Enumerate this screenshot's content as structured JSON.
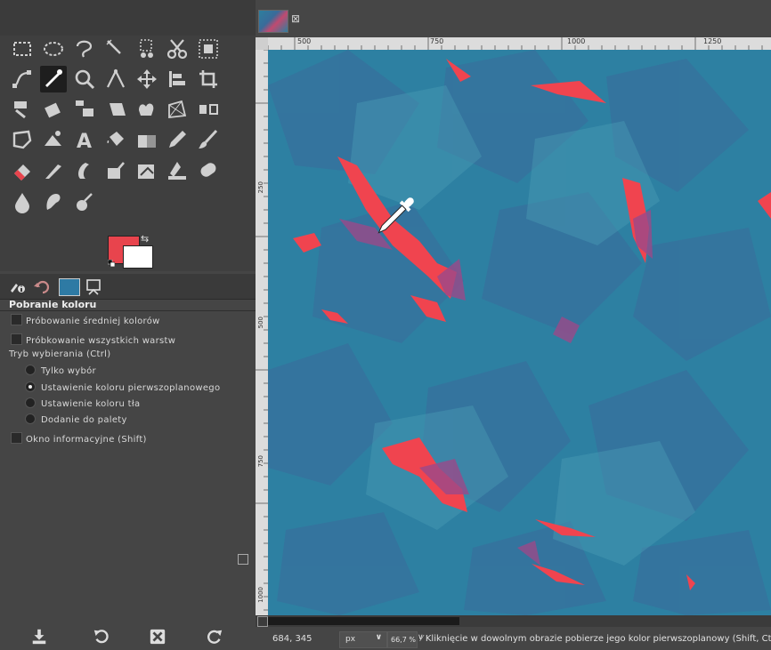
{
  "toolbox": {
    "tools": [
      "rect-select-icon",
      "ellipse-select-icon",
      "free-select-icon",
      "fuzzy-select-icon",
      "color-select-icon",
      "scissors-select-icon",
      "foreground-select-icon",
      "paths-icon",
      "color-picker-icon",
      "zoom-icon",
      "measure-icon",
      "move-icon",
      "align-icon",
      "crop-icon",
      "unified-transform-icon",
      "rotate-icon",
      "scale-icon",
      "shear-icon",
      "warp-icon",
      "perspective-icon",
      "flip-icon",
      "cage-icon",
      "handle-transform-icon",
      "text-icon",
      "bucket-fill-icon",
      "gradient-icon",
      "pencil-icon",
      "paintbrush-icon",
      "eraser-icon",
      "airbrush-icon",
      "ink-icon",
      "mypaint-brush-icon",
      "clone-icon",
      "heal-icon",
      "perspective-clone-icon",
      "blur-icon",
      "smudge-icon",
      "dodge-burn-icon"
    ],
    "active_tool": "color-picker-icon",
    "foreground_color": "#e8444d",
    "background_color": "#ffffff"
  },
  "dock": {
    "tabs": [
      "tool-options-tab",
      "undo-history-tab",
      "images-tab",
      "device-status-tab"
    ]
  },
  "options": {
    "title": "Pobranie koloru",
    "sample_average": "Próbowanie średniej kolorów",
    "sample_merged": "Próbkowanie wszystkich warstw",
    "pick_mode_label": "Tryb wybierania  (Ctrl)",
    "mode_pick_only": "Tylko wybór",
    "mode_set_fg": "Ustawienie koloru pierwszoplanowego",
    "mode_set_bg": "Ustawienie koloru tła",
    "mode_add_palette": "Dodanie do palety",
    "use_info_window": "Okno informacyjne  (Shift)",
    "selected_mode": "mode_set_fg"
  },
  "image_tab": {
    "close_glyph": "⊠"
  },
  "ruler": {
    "top_labels": [
      "500",
      "750",
      "1000",
      "1250"
    ],
    "left_labels": [
      "250",
      "500",
      "750",
      "1000"
    ]
  },
  "status": {
    "coords": "684, 345",
    "unit": "px",
    "zoom": "66,7 %",
    "message": "Kliknięcie w dowolnym obrazie pobierze jego kolor pierwszoplanowy (Shift, Ctrl)"
  },
  "colors": {
    "canvas_base": "#2d80a2",
    "accent_red": "#f0444f",
    "shape_blue": "#3a6c9b"
  }
}
